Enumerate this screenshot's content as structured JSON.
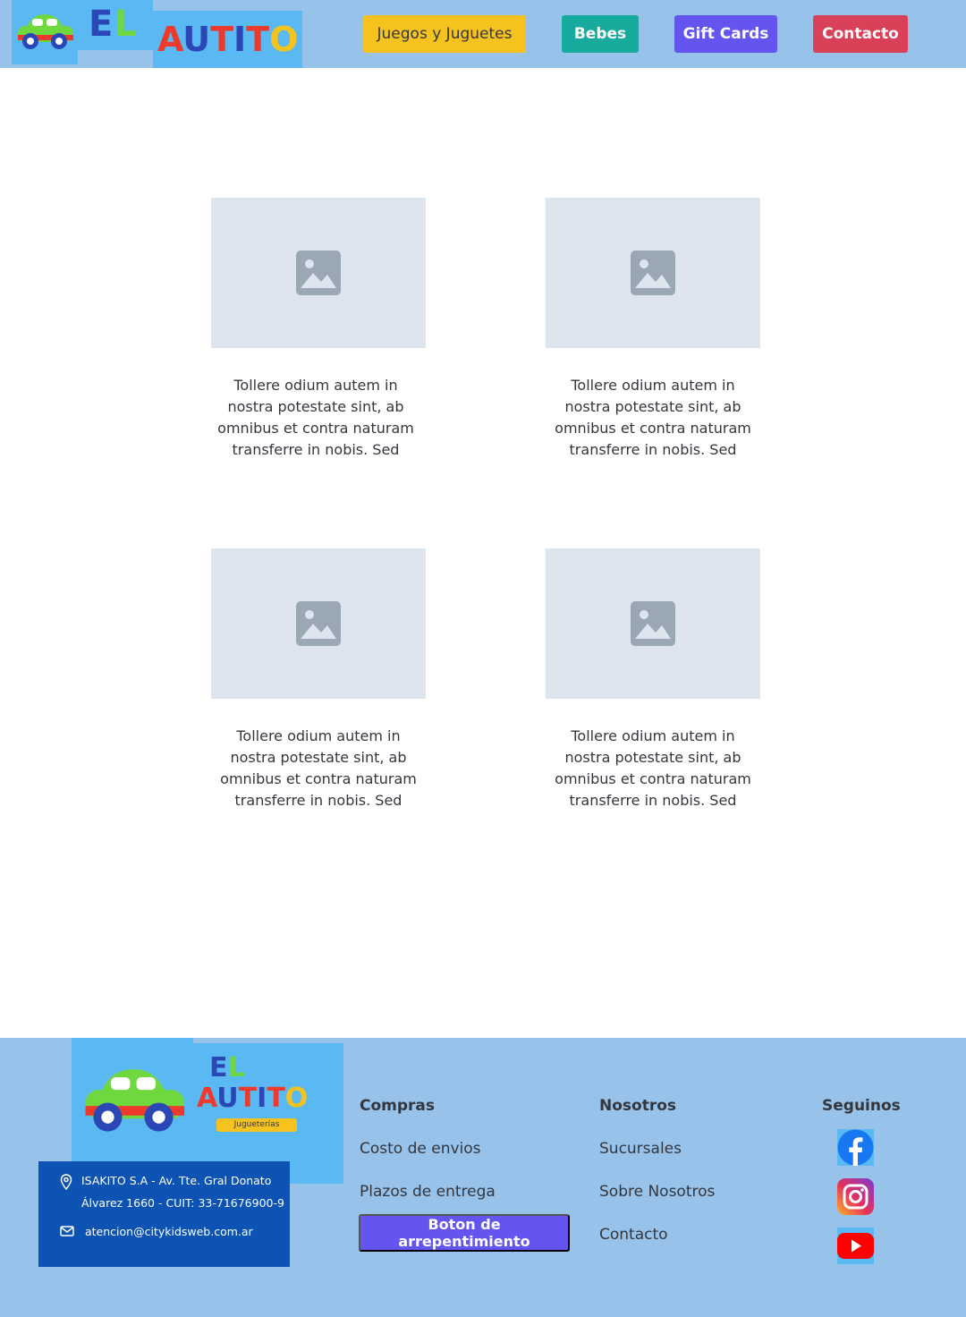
{
  "header": {
    "logo": {
      "el_e": "E",
      "el_l": "L",
      "name": [
        "A",
        "U",
        "T",
        "I",
        "T",
        "O"
      ]
    },
    "nav": [
      {
        "label": "Juegos y Juguetes",
        "color": "#f6c21e"
      },
      {
        "label": "Bebes",
        "color": "#16ab9c"
      },
      {
        "label": "Gift Cards",
        "color": "#6455f1"
      },
      {
        "label": "Contacto",
        "color": "#d94158"
      }
    ]
  },
  "cards": [
    {
      "text_lines": [
        "Tollere odium autem in",
        "nostra potestate sint, ab",
        "omnibus et contra naturam",
        "transferre in nobis. Sed"
      ]
    },
    {
      "text_lines": [
        "Tollere odium autem in",
        "nostra potestate sint, ab",
        "omnibus et contra naturam",
        "transferre in nobis. Sed"
      ]
    },
    {
      "text_lines": [
        "Tollere odium autem in",
        "nostra potestate sint, ab",
        "omnibus et contra naturam",
        "transferre in nobis. Sed"
      ]
    },
    {
      "text_lines": [
        "Tollere odium autem in",
        "nostra potestate sint, ab",
        "omnibus et contra naturam",
        "transferre in nobis. Sed"
      ]
    }
  ],
  "footer": {
    "logo_tag": "Jugueterías",
    "address_line1": "ISAKITO S.A - Av. Tte. Gral Donato",
    "address_line2": "Álvarez 1660 - CUIT: 33-71676900-9",
    "email": "atencion@citykidsweb.com.ar",
    "compras": {
      "title": "Compras",
      "links": [
        "Costo de envios",
        "Plazos de entrega"
      ],
      "button": "Boton de arrepentimiento"
    },
    "nosotros": {
      "title": "Nosotros",
      "links": [
        "Sucursales",
        "Sobre Nosotros",
        "Contacto"
      ]
    },
    "seguinos": {
      "title": "Seguinos",
      "icons": [
        "facebook-icon",
        "instagram-icon",
        "youtube-icon"
      ]
    }
  },
  "colors": {
    "header_bg": "#97c2ea",
    "logo_bg": "#5ab9f2",
    "address_bg": "#0d53b3",
    "placeholder": "#dfe5ee",
    "logo_letters": [
      "#ee3a2d",
      "#2b47b6",
      "#ee3a2d",
      "#2b47b6",
      "#ee3a2d",
      "#f6c21e"
    ]
  }
}
